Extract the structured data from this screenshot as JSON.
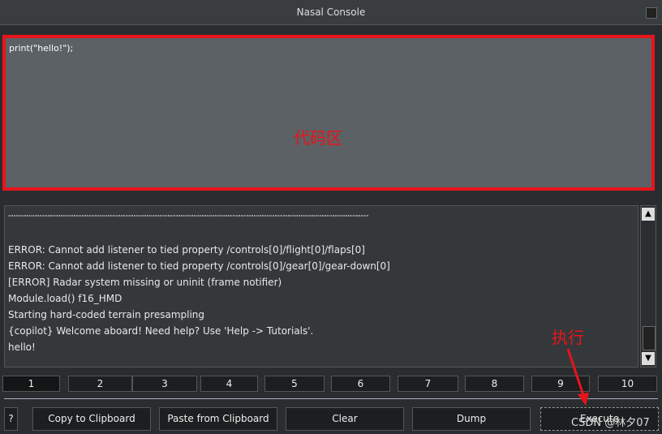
{
  "window": {
    "title": "Nasal Console"
  },
  "code": {
    "value": "print(\"hello!\");"
  },
  "annotations": {
    "code_area": "代码区",
    "execute": "执行",
    "watermark": "CSDN @林夕07"
  },
  "output": {
    "lines": [
      "\"\"\"\"\"\"\"\"\"\"\"\"\"\"\"\"\"\"\"\"\"\"\"\"\"\"\"\"\"\"\"\"\"\"\"\"\"\"\"\"\"\"\"\"\"\"\"\"\"\"\"\"\"\"\"\"\"\"\"\"\"\"\"\"\"\"\"\"\"\"\"\"\"\"\"\"\"\"\"\"\"\"\"\"\"\"\"\"\"\"\"\"\"\"\"\"\"\"\"\"\"\"\"\"\"\"\"\"\"\"\"\"\"\"\"\"\"\"\"\"\"\"\"\"\"\"\"\"\"\"\"\"\"\"\"\"\"\"",
      "",
      "ERROR: Cannot add listener to tied property /controls[0]/flight[0]/flaps[0]",
      "ERROR: Cannot add listener to tied property /controls[0]/gear[0]/gear-down[0]",
      "[ERROR] Radar system missing or uninit (frame notifier)",
      "Module.load() f16_HMD",
      "Starting hard-coded terrain presampling",
      "{copilot} Welcome aboard! Need help? Use 'Help -> Tutorials'.",
      "hello!"
    ]
  },
  "scrollbar": {
    "up": "▲",
    "down": "▼"
  },
  "tabs": [
    "1",
    "2",
    "3",
    "4",
    "5",
    "6",
    "7",
    "8",
    "9",
    "10"
  ],
  "buttons": {
    "help": "?",
    "copy": "Copy to Clipboard",
    "paste": "Paste from Clipboard",
    "clear": "Clear",
    "dump": "Dump",
    "execute": "Execute"
  },
  "colors": {
    "annotation": "#e8141a"
  }
}
